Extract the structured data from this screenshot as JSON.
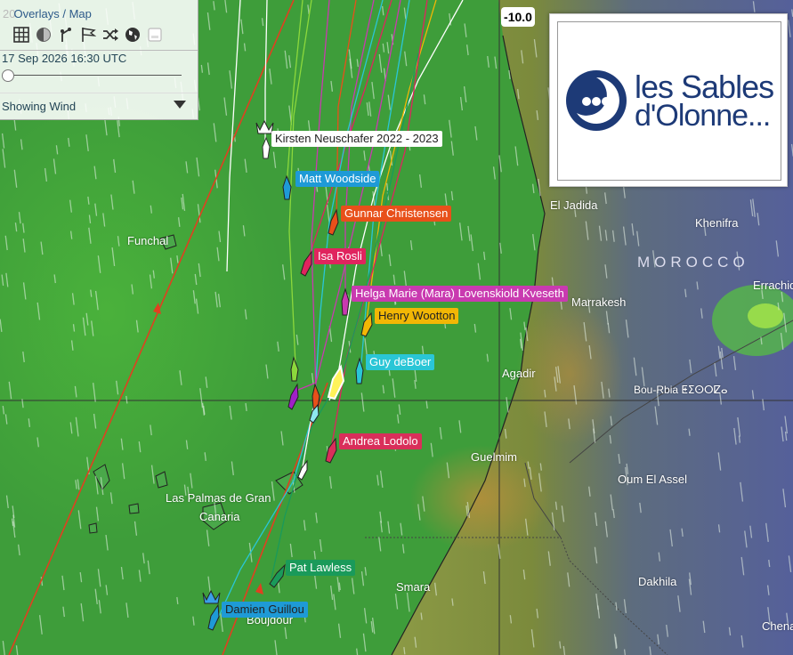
{
  "panel": {
    "year_fragment": "20",
    "title": "Overlays / Map",
    "datetime": "17 Sep 2026 16:30 UTC",
    "wind_mode": "Showing Wind",
    "icons": [
      "grid-icon",
      "contrast-icon",
      "route-icon",
      "flags-icon",
      "shuffle-icon",
      "globe-icon",
      "layers-icon"
    ],
    "slider_progress": 0.0
  },
  "scale_value": "-10.0",
  "logo": {
    "line1": "les Sables",
    "line2": "d'Olonne...",
    "color": "#1d3a77"
  },
  "boats": [
    {
      "name": "Kirsten Neuschafer 2022 - 2023",
      "color": "#ffffff",
      "text_color": "#222222"
    },
    {
      "name": "Matt Woodside",
      "color": "#1e9ad6",
      "text_color": "#ffffff"
    },
    {
      "name": "Gunnar Christensen",
      "color": "#e8501a",
      "text_color": "#ffffff"
    },
    {
      "name": "Isa Rosli",
      "color": "#e0245e",
      "text_color": "#ffffff"
    },
    {
      "name": "Helga Marie (Mara) Lovenskiold Kveseth",
      "color": "#c93ab0",
      "text_color": "#ffffff"
    },
    {
      "name": "Henry Wootton",
      "color": "#f2b705",
      "text_color": "#222222"
    },
    {
      "name": "Guy deBoer",
      "color": "#2ac6d6",
      "text_color": "#ffffff"
    },
    {
      "name": "Andrea Lodolo",
      "color": "#d92f5a",
      "text_color": "#ffffff"
    },
    {
      "name": "Pat Lawless",
      "color": "#1a9a5a",
      "text_color": "#ffffff"
    },
    {
      "name": "Damien Guillou",
      "color": "#1e9ad6",
      "text_color": "#222222"
    }
  ],
  "places": {
    "funchal": "Funchal",
    "el_jadida": "El Jadida",
    "khenifra": "Khenifra",
    "errachidia": "Errachid",
    "marrakesh": "Marrakesh",
    "agadir": "Agadir",
    "bou_rbia": "Bou-Rbia ⵟⵉⵙⵔⵇⴰ",
    "guelmim": "Guelmim",
    "oum_el_assel": "Oum El Assel",
    "las_palmas": "Las Palmas de Gran",
    "canaria": "Canaria",
    "smara": "Smara",
    "dakhila": "Dakhila",
    "boujdour": "Boujdour",
    "chenachane": "Chena"
  },
  "country": "MOROCCO"
}
